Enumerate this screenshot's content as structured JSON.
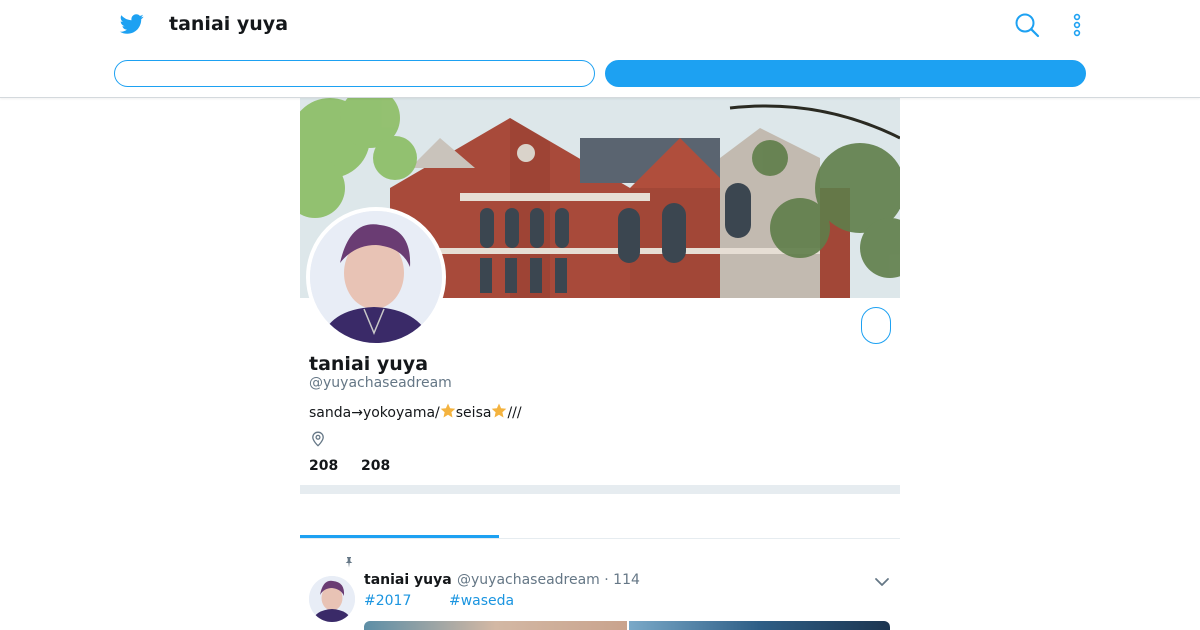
{
  "header": {
    "title": "taniai yuya",
    "logo_icon": "twitter-bird-icon",
    "search_icon": "search-icon",
    "more_icon": "more-vertical-icon",
    "login_label": "",
    "signup_label": ""
  },
  "profile": {
    "name": "taniai yuya",
    "handle": "@yuyachaseadream",
    "bio_part1": "sanda→yokoyama/",
    "bio_part2": "seisa",
    "bio_part3": "///",
    "location_icon": "location-pin-icon",
    "stat_following": "208",
    "stat_followers": "208",
    "follow_label": ""
  },
  "tabs": {
    "active_label": ""
  },
  "tweet": {
    "pinned_icon": "pin-icon",
    "name": "taniai yuya",
    "handle_meta": "@yuyachaseadream · 114",
    "tag1": "#2017",
    "tag2": "#waseda",
    "caret_icon": "chevron-down-icon"
  },
  "colors": {
    "accent": "#1da1f2",
    "link": "#1b95e0",
    "text": "#14171a",
    "muted": "#657786",
    "divider": "#e6ecf0"
  }
}
